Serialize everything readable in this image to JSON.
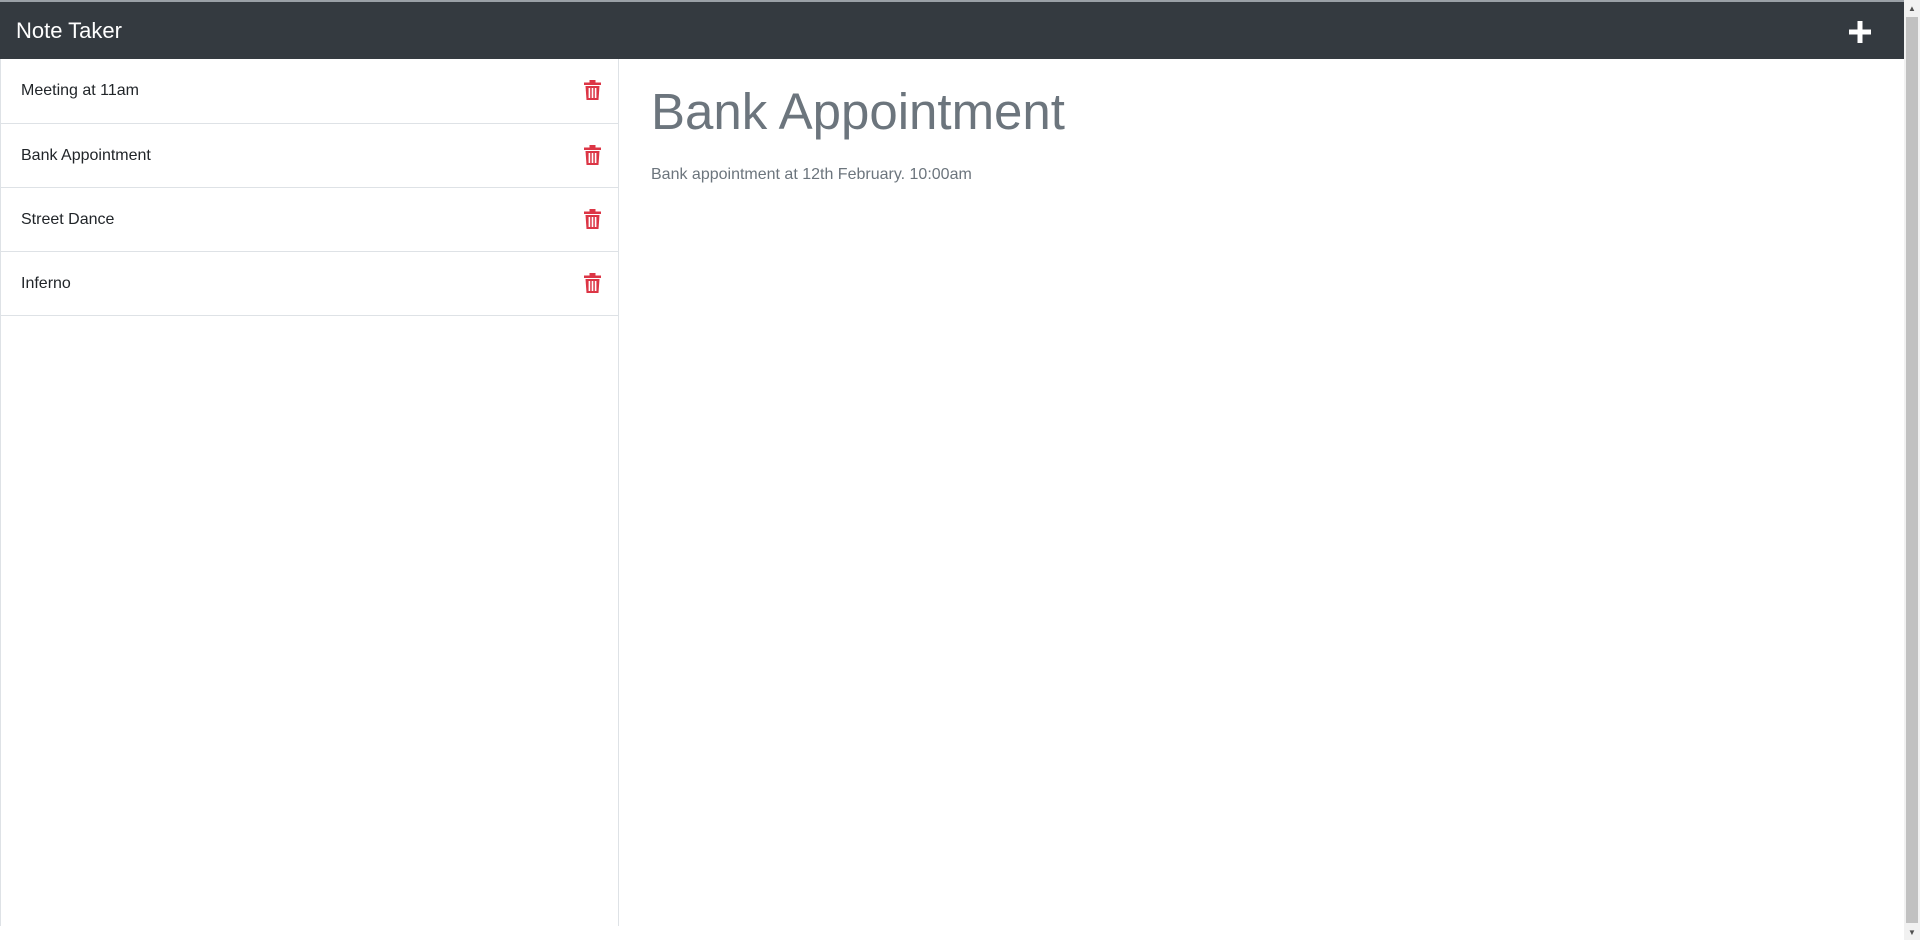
{
  "header": {
    "brand": "Note Taker",
    "new_note_icon": "plus-icon"
  },
  "sidebar": {
    "delete_icon": "trash-icon",
    "delete_color": "#dc3545",
    "notes": [
      {
        "title": "Meeting at 11am"
      },
      {
        "title": "Bank Appointment"
      },
      {
        "title": "Street Dance"
      },
      {
        "title": "Inferno"
      }
    ]
  },
  "main": {
    "note_title": "Bank Appointment",
    "note_text": "Bank appointment at 12th February. 10:00am"
  },
  "colors": {
    "navbar": "#343a40",
    "muted_text": "#6c757d",
    "delete": "#dc3545"
  }
}
